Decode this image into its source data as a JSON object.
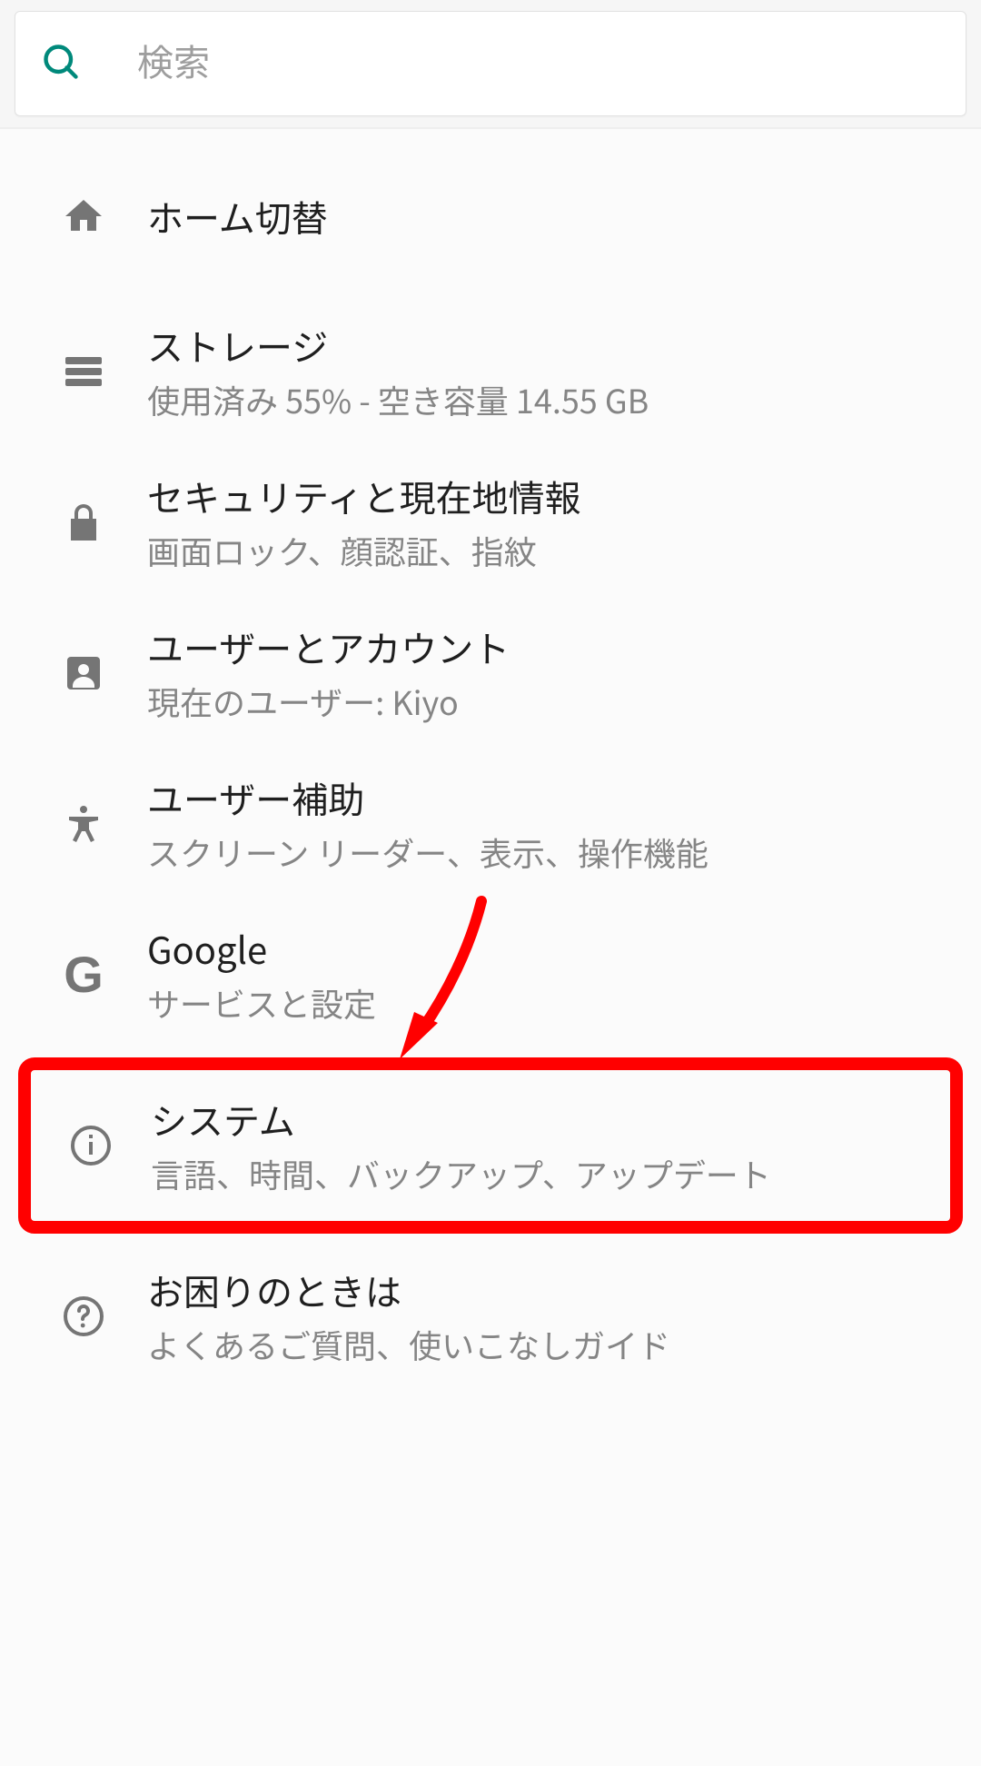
{
  "search": {
    "placeholder": "検索"
  },
  "items": [
    {
      "icon": "home-icon",
      "title": "ホーム切替",
      "subtitle": null
    },
    {
      "icon": "storage-icon",
      "title": "ストレージ",
      "subtitle": "使用済み 55% - 空き容量 14.55 GB"
    },
    {
      "icon": "lock-icon",
      "title": "セキュリティと現在地情報",
      "subtitle": "画面ロック、顔認証、指紋"
    },
    {
      "icon": "account-icon",
      "title": "ユーザーとアカウント",
      "subtitle": "現在のユーザー: Kiyo"
    },
    {
      "icon": "accessibility-icon",
      "title": "ユーザー補助",
      "subtitle": "スクリーン リーダー、表示、操作機能"
    },
    {
      "icon": "google-icon",
      "title": "Google",
      "subtitle": "サービスと設定"
    },
    {
      "icon": "info-icon",
      "title": "システム",
      "subtitle": "言語、時間、バックアップ、アップデート"
    },
    {
      "icon": "help-icon",
      "title": "お困りのときは",
      "subtitle": "よくあるご質問、使いこなしガイド"
    }
  ],
  "annotation": {
    "highlight_index": 6,
    "arrow_points_to_index": 6,
    "color": "#ff0000"
  }
}
